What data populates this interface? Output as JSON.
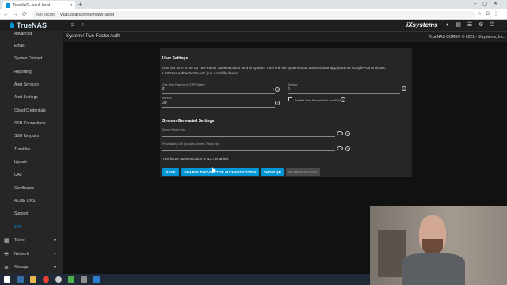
{
  "browser": {
    "tab_title": "TrueNAS - vault.local",
    "not_secure": "Not secure",
    "url": "vault.local/ui/system/two-factor"
  },
  "topbar": {
    "brand": "TrueNAS",
    "ix": "iXsystems"
  },
  "breadcrumb": {
    "path": "System / Two-Factor Auth",
    "copyright": "TrueNAS CORE® © 2021 - iXsystems, Inc."
  },
  "sidebar": {
    "items": [
      {
        "label": "Advanced"
      },
      {
        "label": "Email"
      },
      {
        "label": "System Dataset"
      },
      {
        "label": "Reporting"
      },
      {
        "label": "Alert Services"
      },
      {
        "label": "Alert Settings"
      },
      {
        "label": "Cloud Credentials"
      },
      {
        "label": "SSH Connections"
      },
      {
        "label": "SSH Keypairs"
      },
      {
        "label": "Tunables"
      },
      {
        "label": "Update"
      },
      {
        "label": "CAs"
      },
      {
        "label": "Certificates"
      },
      {
        "label": "ACME DNS"
      },
      {
        "label": "Support"
      },
      {
        "label": "2FA"
      }
    ],
    "groups": [
      {
        "label": "Tasks"
      },
      {
        "label": "Network"
      },
      {
        "label": "Storage"
      }
    ]
  },
  "user_settings": {
    "title": "User Settings",
    "description": "Use this form to set up Two-Factor Authentication for this system. Then link the system to an authenticator app (such as Google Authenticator, LastPass Authenticator, etc.) on a mobile device.",
    "otp_digits_label": "One-Time Password (OTP) Digits *",
    "otp_digits_value": "6",
    "window_label": "Window",
    "window_value": "0",
    "interval_label": "Interval",
    "interval_value": "30",
    "ssh_checkbox_label": "Enable Two-Factor Auth for SSH"
  },
  "generated": {
    "title": "System-Generated Settings",
    "secret_label": "Secret (Read only)",
    "uri_label": "Provisioning URI (includes Secret - Read only)"
  },
  "status": "Two-factor authentication is NOT enabled.",
  "buttons": {
    "save": "SAVE",
    "enable": "ENABLE TWO-FACTOR AUTHENTICATION",
    "show_qr": "SHOW QR",
    "renew": "RENEW SECRET"
  },
  "colors": {
    "accent": "#0095d5",
    "panel": "#262626",
    "background": "#111111"
  }
}
